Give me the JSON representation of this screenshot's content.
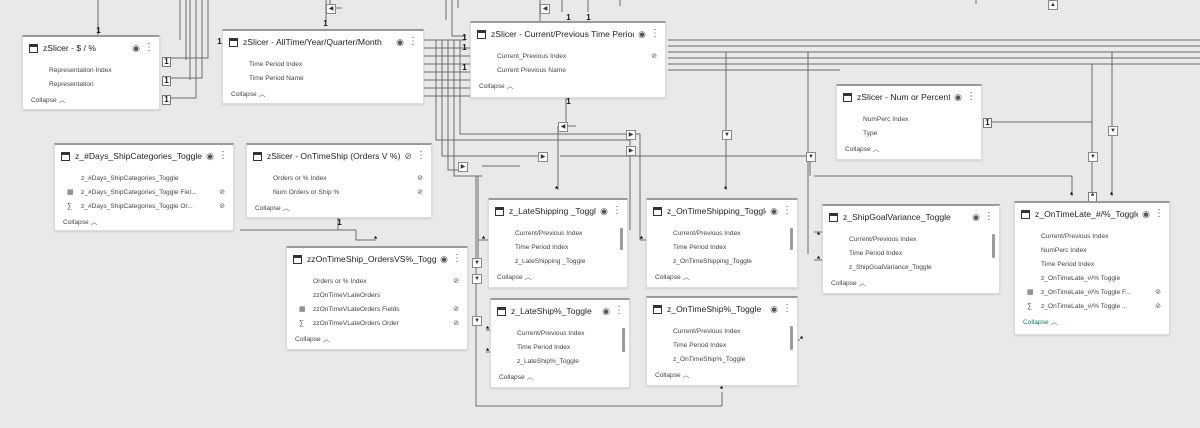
{
  "labels": {
    "one": "1",
    "many": "*"
  },
  "icons": {
    "visibility": "eye-icon",
    "hidden": "eye-slash-icon",
    "more": "more-options-icon",
    "table": "table-icon",
    "sigma": "sigma-icon",
    "folder": "field-group-icon"
  },
  "cards": {
    "slicer_dollar": {
      "title": "zSlicer - $ / %",
      "fields": [
        "Representation Index",
        "Representation"
      ],
      "collapse": "Collapse"
    },
    "slicer_alltime": {
      "title": "zSlicer - AllTime/Year/Quarter/Month",
      "fields": [
        "Time Period Index",
        "Time Period Name"
      ],
      "collapse": "Collapse"
    },
    "slicer_current": {
      "title": "zSlicer - Current/Previous Time Period",
      "fields": [
        "Current_Previous Index",
        "Current Previous Name"
      ],
      "collapse": "Collapse"
    },
    "slicer_numperc": {
      "title": "zSlicer - Num or Percent",
      "fields": [
        "NumPerc Index",
        "Type"
      ],
      "collapse": "Collapse"
    },
    "days_ship": {
      "title": "z_#Days_ShipCategories_Toggle",
      "fields": [
        "z_#Days_ShipCategories_Toggle",
        "z_#Days_ShipCategories_Toggle Fiel...",
        "z_#Days_ShipCategories_Toggle Or..."
      ],
      "collapse": "Collapse"
    },
    "slicer_ontime": {
      "title": "zSlicer - OnTimeShip (Orders V %)",
      "fields": [
        "Orders or % Index",
        "Num Orders or Ship %"
      ],
      "collapse": "Collapse"
    },
    "ontime_ordersvs": {
      "title": "zzOnTimeShip_OrdersVS%_Toggle",
      "fields": [
        "Orders or % Index",
        "zzOnTimeVLateOrders",
        "zzOnTimeVLateOrders Fields",
        "zzOnTimeVLateOrders Order"
      ],
      "collapse": "Collapse"
    },
    "lateshipping": {
      "title": "z_LateShipping _Toggle",
      "fields": [
        "Current/Previous Index",
        "Time Period Index",
        "z_LateShipping _Toggle"
      ],
      "collapse": "Collapse"
    },
    "ontimeshipping": {
      "title": "z_OnTimeShipping_Toggle",
      "fields": [
        "Current/Previous Index",
        "Time Period Index",
        "z_OnTimeShipping_Toggle"
      ],
      "collapse": "Collapse"
    },
    "shipgoal": {
      "title": "z_ShipGoalVariance_Toggle",
      "fields": [
        "Current/Previous Index",
        "Time Period Index",
        "z_ShipGoalVariance_Toggle"
      ],
      "collapse": "Collapse"
    },
    "ontimelate": {
      "title": "z_OnTimeLate_#/%_Toggle",
      "fields": [
        "Current/Previous Index",
        "NumPerc Index",
        "Time Period Index",
        "z_OnTimeLate_#/% Toggle",
        "z_OnTimeLate_#/% Toggle F...",
        "z_OnTimeLate_#/% Toggle ..."
      ],
      "collapse": "Collapse"
    },
    "lateship_pct": {
      "title": "z_LateShip%_Toggle",
      "fields": [
        "Current/Previous Index",
        "Time Period Index",
        "z_LateShip%_Toggle"
      ],
      "collapse": "Collapse"
    },
    "ontimeship_pct": {
      "title": "z_OnTimeShip%_Toggle",
      "fields": [
        "Current/Previous Index",
        "Time Period Index",
        "z_OnTimeShip%_Toggle"
      ],
      "collapse": "Collapse"
    }
  }
}
